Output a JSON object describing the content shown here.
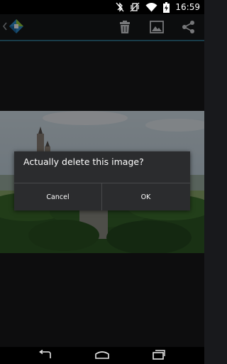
{
  "status_bar": {
    "time": "16:59",
    "icons": [
      "bluetooth-muted-icon",
      "vibrate-icon",
      "wifi-icon",
      "battery-charging-icon"
    ]
  },
  "action_bar": {
    "nav_icon": "up-caret-icon",
    "logo_icon": "app-logo-icon",
    "actions": [
      "delete-icon",
      "set-wallpaper-icon",
      "share-icon"
    ]
  },
  "dialog": {
    "message": "Actually delete this image?",
    "cancel_label": "Cancel",
    "ok_label": "OK"
  },
  "nav_bar": {
    "buttons": [
      "back-icon",
      "home-icon",
      "recents-icon"
    ]
  },
  "colors": {
    "accent": "#2f6d86",
    "background": "#18191c",
    "dialog": "#2b2c2e"
  }
}
